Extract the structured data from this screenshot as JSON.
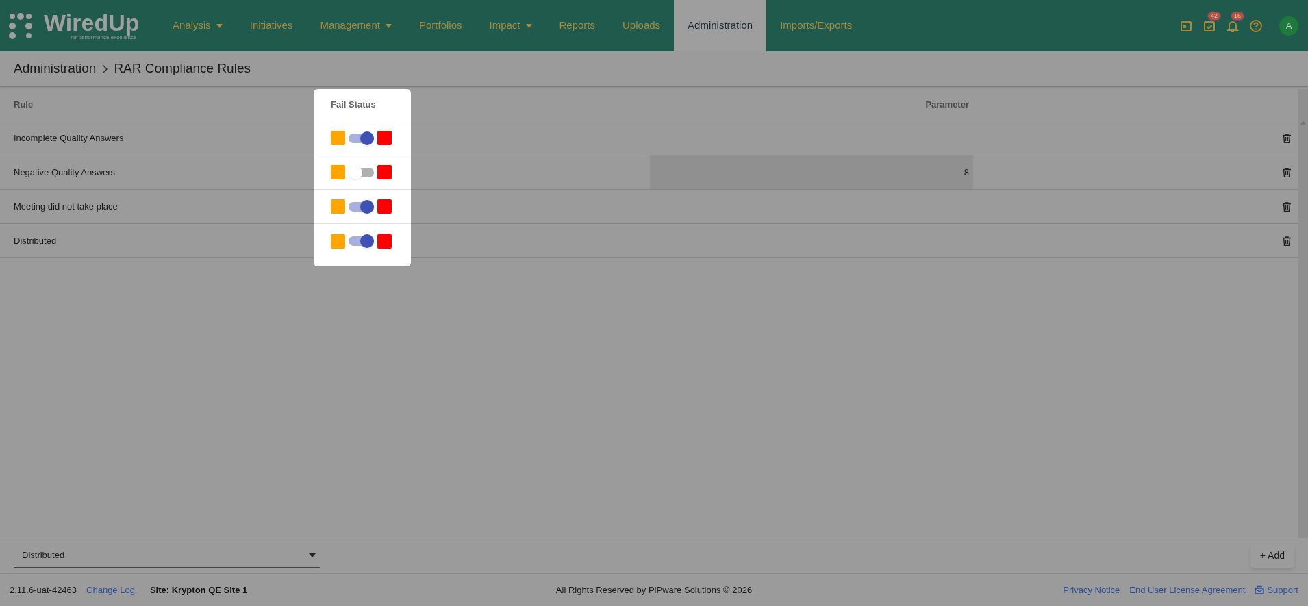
{
  "logo": {
    "name": "WiredUp",
    "tagline": "for performance excellence"
  },
  "nav": [
    {
      "label": "Analysis",
      "dropdown": true,
      "selected": false
    },
    {
      "label": "Initiatives",
      "dropdown": false,
      "selected": false
    },
    {
      "label": "Management",
      "dropdown": true,
      "selected": false
    },
    {
      "label": "Portfolios",
      "dropdown": false,
      "selected": false
    },
    {
      "label": "Impact",
      "dropdown": true,
      "selected": false
    },
    {
      "label": "Reports",
      "dropdown": false,
      "selected": false
    },
    {
      "label": "Uploads",
      "dropdown": false,
      "selected": false
    },
    {
      "label": "Administration",
      "dropdown": false,
      "selected": true
    },
    {
      "label": "Imports/Exports",
      "dropdown": false,
      "selected": false
    }
  ],
  "header_icons": [
    {
      "kind": "calendar"
    },
    {
      "kind": "tasks",
      "badge": "42"
    },
    {
      "kind": "bell",
      "badge": "16"
    },
    {
      "kind": "help"
    }
  ],
  "avatar": "A",
  "breadcrumb": [
    "Administration",
    "RAR Compliance Rules"
  ],
  "table": {
    "columns": [
      "Rule",
      "Fail Status",
      "Parameter"
    ],
    "rows": [
      {
        "rule": "Incomplete Quality Answers",
        "on": true
      },
      {
        "rule": "Negative Quality Answers",
        "on": false,
        "parameter": "8"
      },
      {
        "rule": "Meeting did not take place",
        "on": true
      },
      {
        "rule": "Distributed",
        "on": true
      }
    ]
  },
  "rule_select": {
    "value": "Distributed"
  },
  "add_button": "+ Add",
  "footer": {
    "version": "2.11.6-uat-42463",
    "change_log": "Change Log",
    "site": "Site: Krypton QE Site 1",
    "copyright": "All Rights Reserved by PiPware Solutions © 2026",
    "links": [
      "Privacy Notice",
      "End User License Agreement"
    ],
    "support": "Support"
  }
}
